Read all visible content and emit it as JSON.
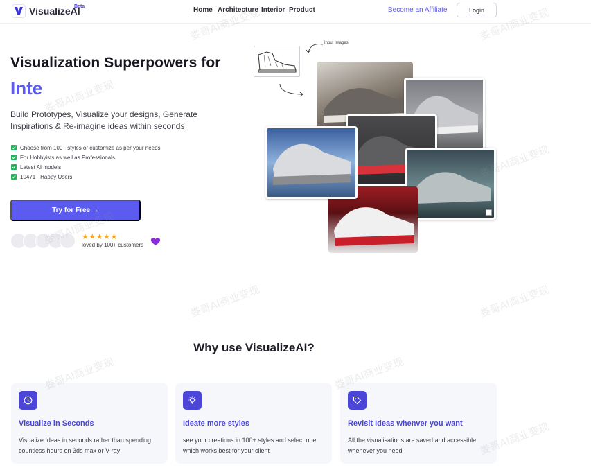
{
  "header": {
    "logo_text": "VisualizeAI",
    "beta_badge": "Beta",
    "nav": [
      "Home",
      "Architecture",
      "Interior",
      "Product"
    ],
    "affiliate_link": "Become an Affiliate",
    "login_label": "Login"
  },
  "hero": {
    "title": "Visualization Superpowers for",
    "typed_word": "Inte",
    "description": "Build Prototypes, Visualize your designs, Generate Inspirations & Re-imagine ideas within seconds",
    "features": [
      "Choose from 100+ styles or customize as per your needs",
      "For Hobbyists as well as Professionals",
      "Latest AI models",
      "10471+ Happy Users"
    ],
    "cta_label": "Try for Free →",
    "stars": "★★★★★",
    "loved_text": "loved by 100+ customers"
  },
  "collage": {
    "input_label": "Input Images"
  },
  "why": {
    "title": "Why use VisualizeAI?",
    "cards": [
      {
        "icon": "clock-icon",
        "title": "Visualize in Seconds",
        "text": "Visualize Ideas in seconds rather than spending countless hours on 3ds max or V-ray"
      },
      {
        "icon": "lightbulb-icon",
        "title": "Ideate more styles",
        "text": "see your creations in 100+ styles and select one which works best for your client"
      },
      {
        "icon": "tag-icon",
        "title": "Revisit Ideas whenver you want",
        "text": "All the visualisations are saved and accessible whenever you need"
      }
    ]
  },
  "watermark": "娄哥AI商业变现",
  "colors": {
    "accent": "#5b5bef",
    "check": "#20b35a",
    "star": "#f5a623",
    "card_bg": "#f6f7fb"
  }
}
